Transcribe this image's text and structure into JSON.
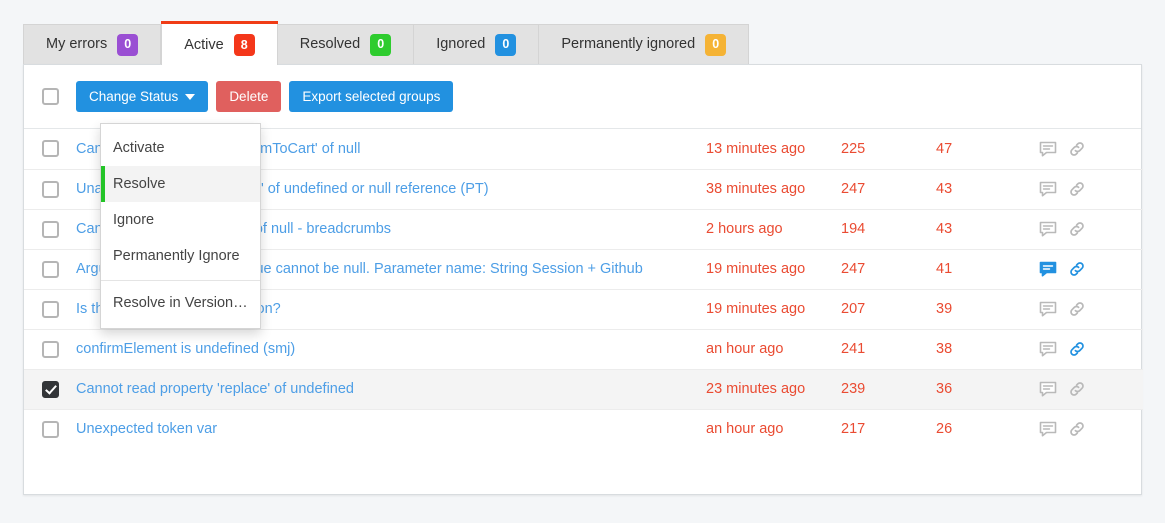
{
  "tabs": [
    {
      "label": "My errors",
      "count": "0",
      "color": "#9a4fd3",
      "active": false
    },
    {
      "label": "Active",
      "count": "8",
      "color": "#f4371a",
      "active": true
    },
    {
      "label": "Resolved",
      "count": "0",
      "color": "#2ecc2e",
      "active": false
    },
    {
      "label": "Ignored",
      "count": "0",
      "color": "#2291e0",
      "active": false
    },
    {
      "label": "Permanently ignored",
      "count": "0",
      "color": "#f5b335",
      "active": false
    }
  ],
  "toolbar": {
    "change_status_label": "Change Status",
    "delete_label": "Delete",
    "export_label": "Export selected groups",
    "select_all_checked": false
  },
  "dropdown": {
    "open": true,
    "items": [
      {
        "label": "Activate",
        "highlight": false,
        "separator_before": false
      },
      {
        "label": "Resolve",
        "highlight": true,
        "separator_before": false
      },
      {
        "label": "Ignore",
        "highlight": false,
        "separator_before": false
      },
      {
        "label": "Permanently Ignore",
        "highlight": false,
        "separator_before": false
      },
      {
        "label": "Resolve in Version…",
        "highlight": false,
        "separator_before": true
      }
    ]
  },
  "table": {
    "rows": [
      {
        "checked": false,
        "title": "Cannot read property 'addItemToCart' of null",
        "time": "13 minutes ago",
        "occurrences": "225",
        "users": "47",
        "comment_active": false,
        "link_active": false
      },
      {
        "checked": false,
        "title": "Unable to get property 'value' of undefined or null reference (PT)",
        "time": "38 minutes ago",
        "occurrences": "247",
        "users": "43",
        "comment_active": false,
        "link_active": false
      },
      {
        "checked": false,
        "title": "Cannot read property 'char' of null - breadcrumbs",
        "time": "2 hours ago",
        "occurrences": "194",
        "users": "43",
        "comment_active": false,
        "link_active": false
      },
      {
        "checked": false,
        "title": "ArgumentNullException: Value cannot be null. Parameter name: String Session + Github",
        "time": "19 minutes ago",
        "occurrences": "247",
        "users": "41",
        "comment_active": true,
        "link_active": true
      },
      {
        "checked": false,
        "title": "Is this error worth investigation?",
        "time": "19 minutes ago",
        "occurrences": "207",
        "users": "39",
        "comment_active": false,
        "link_active": false
      },
      {
        "checked": false,
        "title": "confirmElement is undefined (smj)",
        "time": "an hour ago",
        "occurrences": "241",
        "users": "38",
        "comment_active": false,
        "link_active": true
      },
      {
        "checked": true,
        "title": "Cannot read property 'replace' of undefined",
        "time": "23 minutes ago",
        "occurrences": "239",
        "users": "36",
        "comment_active": false,
        "link_active": false
      },
      {
        "checked": false,
        "title": "Unexpected token var",
        "time": "an hour ago",
        "occurrences": "217",
        "users": "26",
        "comment_active": false,
        "link_active": false
      }
    ]
  },
  "colors": {
    "link": "#4d9ee6",
    "value_red": "#ea4b32",
    "primary_blue": "#2291e0",
    "danger_red": "#e0605e",
    "highlight_green": "#23c427",
    "active_tab_bar": "#f03c16",
    "icon_active": "#2291e0",
    "icon_inactive": "#b9b9b9"
  }
}
